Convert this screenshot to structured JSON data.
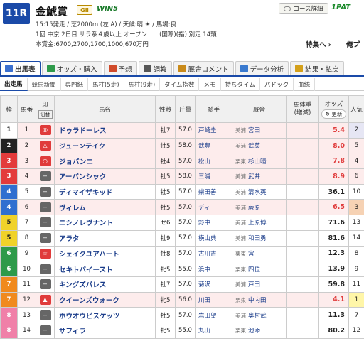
{
  "header": {
    "race_no": "11R",
    "race_name": "金鯱賞",
    "grade": "GⅡ",
    "win5": "WIN5",
    "meta_line1": "15:15発走 / 芝2000m (左 A) / 天候:晴 ☀ / 馬場:良",
    "meta_line2": "1回 中京 2日目 サラ系４歳以上 オープン　　(国際)(指) 別定 14頭",
    "meta_line3": "本賞金:6700,2700,1700,1000,670万円",
    "course_btn": "コース詳細",
    "ipat": "1PAT",
    "feature": "特集へ ›",
    "mine": "俺プ"
  },
  "tabs": [
    {
      "label": "出馬表",
      "color": "#3a6fcf"
    },
    {
      "label": "オッズ・購入",
      "color": "#2e9a4a"
    },
    {
      "label": "予想",
      "color": "#d04a2a"
    },
    {
      "label": "調教",
      "color": "#555"
    },
    {
      "label": "厩舎コメント",
      "color": "#c98a1a"
    },
    {
      "label": "データ分析",
      "color": "#3a7acf"
    },
    {
      "label": "結果・払戻",
      "color": "#d4a01a"
    }
  ],
  "subtabs": [
    "出走馬",
    "競馬新聞",
    "専門紙",
    "馬柱(5走)",
    "馬柱(9走)",
    "タイム指数",
    "メモ",
    "持ちタイム",
    "パドック",
    "血統"
  ],
  "table": {
    "headers": {
      "waku": "枠",
      "umaban": "馬番",
      "mark": "印",
      "kiri": "切替",
      "name": "馬名",
      "sex": "性齢",
      "weight": "斤量",
      "jockey": "騎手",
      "trainer": "厩舎",
      "bodyweight": "馬体重\n(増減)",
      "odds": "オッズ",
      "refresh": "更新",
      "pop": "人気"
    },
    "rows": [
      {
        "waku": "1",
        "num": "1",
        "mark": "◎",
        "mark_type": "red",
        "name": "ドゥラドーレス",
        "sex": "牡7",
        "wt": "57.0",
        "jockey": "戸崎圭",
        "reg": "美浦",
        "trainer": "宮田",
        "odds": "5.4",
        "hot": true,
        "pop": "2",
        "pink": true
      },
      {
        "waku": "2",
        "num": "2",
        "mark": "△",
        "mark_type": "red",
        "name": "ジューンテイク",
        "sex": "牡5",
        "wt": "58.0",
        "jockey": "武豊",
        "reg": "美浦",
        "trainer": "武英",
        "odds": "8.0",
        "hot": true,
        "pop": "5",
        "pink": true
      },
      {
        "waku": "3",
        "num": "3",
        "mark": "○",
        "mark_type": "red",
        "name": "ジョバンニ",
        "sex": "牡4",
        "wt": "57.0",
        "jockey": "松山",
        "reg": "栗東",
        "trainer": "杉山晴",
        "odds": "7.8",
        "hot": true,
        "pop": "4",
        "pink": true
      },
      {
        "waku": "3",
        "num": "4",
        "mark": "--",
        "mark_type": "gray",
        "name": "アーバンシック",
        "sex": "牡5",
        "wt": "58.0",
        "jockey": "三浦",
        "reg": "美浦",
        "trainer": "武井",
        "odds": "8.9",
        "hot": true,
        "pop": "6",
        "pink": true
      },
      {
        "waku": "4",
        "num": "5",
        "mark": "--",
        "mark_type": "gray",
        "name": "ディマイザキッド",
        "sex": "牡5",
        "wt": "57.0",
        "jockey": "柴田善",
        "reg": "美浦",
        "trainer": "清水英",
        "odds": "36.1",
        "hot": false,
        "pop": "10",
        "pink": false
      },
      {
        "waku": "4",
        "num": "6",
        "mark": "--",
        "mark_type": "gray",
        "name": "ヴィレム",
        "sex": "牡5",
        "wt": "57.0",
        "jockey": "ディー",
        "reg": "美浦",
        "trainer": "蕨原",
        "odds": "6.5",
        "hot": true,
        "pop": "3",
        "pink": true
      },
      {
        "waku": "5",
        "num": "7",
        "mark": "--",
        "mark_type": "gray",
        "name": "ニシノレヴナント",
        "sex": "セ6",
        "wt": "57.0",
        "jockey": "野中",
        "reg": "美浦",
        "trainer": "上原博",
        "odds": "71.6",
        "hot": false,
        "pop": "13",
        "pink": false
      },
      {
        "waku": "5",
        "num": "8",
        "mark": "--",
        "mark_type": "gray",
        "name": "アラタ",
        "sex": "牡9",
        "wt": "57.0",
        "jockey": "横山典",
        "reg": "美浦",
        "trainer": "和田勇",
        "odds": "81.6",
        "hot": false,
        "pop": "14",
        "pink": false
      },
      {
        "waku": "6",
        "num": "9",
        "mark": "☆",
        "mark_type": "red",
        "name": "シェイクユアハート",
        "sex": "牡8",
        "wt": "57.0",
        "jockey": "古川吉",
        "reg": "栗東",
        "trainer": "宮",
        "odds": "12.3",
        "hot": false,
        "pop": "8",
        "pink": false
      },
      {
        "waku": "6",
        "num": "10",
        "mark": "--",
        "mark_type": "gray",
        "name": "セキトバイースト",
        "sex": "牝5",
        "wt": "55.0",
        "jockey": "浜中",
        "reg": "栗東",
        "trainer": "四位",
        "odds": "13.9",
        "hot": false,
        "pop": "9",
        "pink": false
      },
      {
        "waku": "7",
        "num": "11",
        "mark": "--",
        "mark_type": "gray",
        "name": "キングズパレス",
        "sex": "牡7",
        "wt": "57.0",
        "jockey": "菊沢",
        "reg": "美浦",
        "trainer": "戸田",
        "odds": "59.8",
        "hot": false,
        "pop": "11",
        "pink": false
      },
      {
        "waku": "7",
        "num": "12",
        "mark": "▲",
        "mark_type": "red",
        "name": "クイーンズウォーク",
        "sex": "牝5",
        "wt": "56.0",
        "jockey": "川田",
        "reg": "栗東",
        "trainer": "中内田",
        "odds": "4.1",
        "hot": true,
        "pop": "1",
        "pink": true
      },
      {
        "waku": "8",
        "num": "13",
        "mark": "--",
        "mark_type": "gray",
        "name": "ホウオウビスケッツ",
        "sex": "牡5",
        "wt": "57.0",
        "jockey": "岩田望",
        "reg": "美浦",
        "trainer": "奥村武",
        "odds": "11.3",
        "hot": false,
        "pop": "7",
        "pink": false
      },
      {
        "waku": "8",
        "num": "14",
        "mark": "--",
        "mark_type": "gray",
        "name": "サフィラ",
        "sex": "牝5",
        "wt": "55.0",
        "jockey": "丸山",
        "reg": "栗東",
        "trainer": "池添",
        "odds": "80.2",
        "hot": false,
        "pop": "12",
        "pink": false
      }
    ]
  },
  "waku_colors": {
    "1": {
      "bg": "#ffffff",
      "fg": "#222"
    },
    "2": {
      "bg": "#222222",
      "fg": "#fff"
    },
    "3": {
      "bg": "#e33b3b",
      "fg": "#fff"
    },
    "4": {
      "bg": "#2f6fd0",
      "fg": "#fff"
    },
    "5": {
      "bg": "#f0d22a",
      "fg": "#222"
    },
    "6": {
      "bg": "#2e9a4a",
      "fg": "#fff"
    },
    "7": {
      "bg": "#f08a1e",
      "fg": "#fff"
    },
    "8": {
      "bg": "#f080a8",
      "fg": "#fff"
    }
  }
}
